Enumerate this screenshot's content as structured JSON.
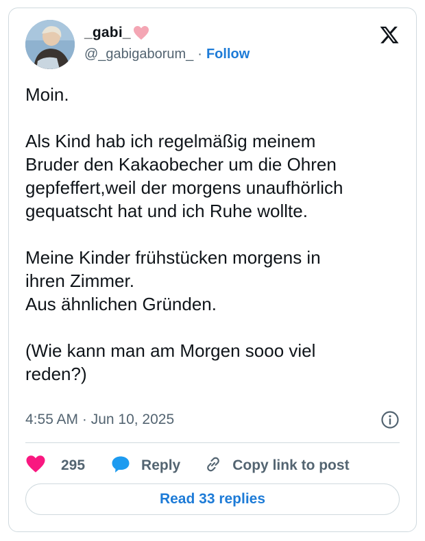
{
  "author": {
    "display_name": "_gabi_",
    "handle": "@_gabigaborum_",
    "separator": "·",
    "follow_label": "Follow",
    "name_emoji": "pink-heart-icon"
  },
  "brand": {
    "logo": "x-logo-icon"
  },
  "tweet": {
    "lines": [
      "Moin.",
      "",
      "Als Kind hab ich regelmäßig meinem",
      "Bruder den Kakaobecher um die Ohren",
      "gepfeffert,weil der morgens unaufhörlich",
      "gequatscht hat und ich Ruhe wollte.",
      "",
      "Meine Kinder frühstücken morgens in",
      "ihren Zimmer.",
      "Aus ähnlichen Gründen.",
      "",
      "(Wie kann man am Morgen sooo viel",
      "reden?)"
    ],
    "timestamp": "4:55 AM · Jun 10, 2025"
  },
  "actions": {
    "like_count": "295",
    "reply_label": "Reply",
    "copy_label": "Copy link to post"
  },
  "footer": {
    "read_replies_label": "Read 33 replies"
  },
  "colors": {
    "like_heart": "#f91880",
    "reply_bubble": "#1d9bf0",
    "link": "#1d7bd7",
    "muted": "#536471",
    "border": "#cfd9de",
    "text": "#0f1419"
  }
}
